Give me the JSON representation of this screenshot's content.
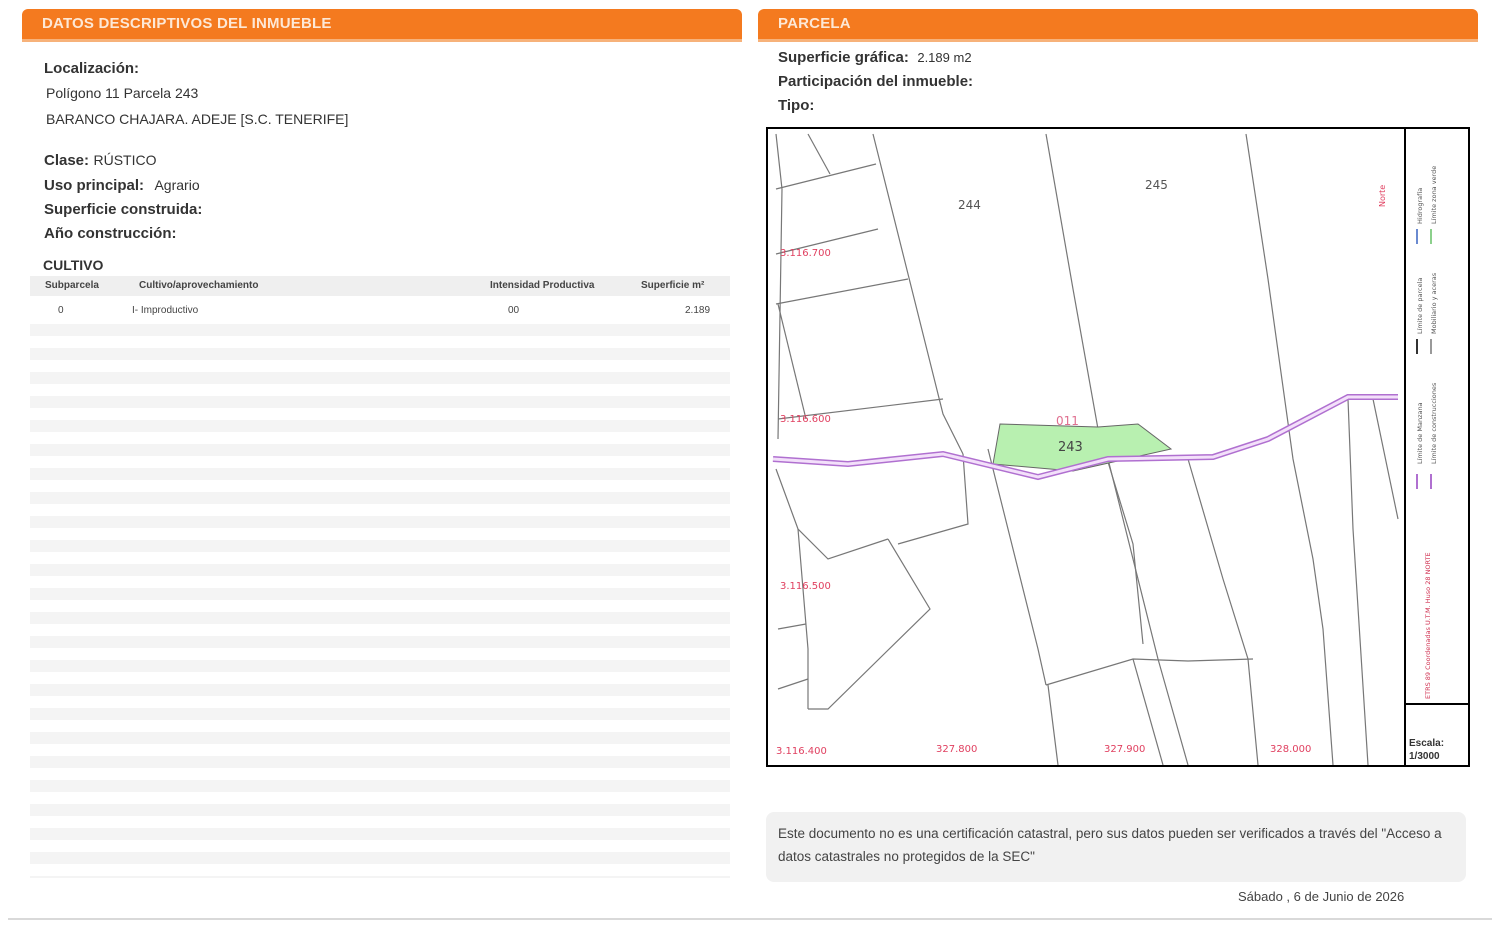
{
  "left": {
    "header": "DATOS DESCRIPTIVOS DEL INMUEBLE",
    "localizacion_label": "Localización:",
    "localizacion_line1": "Polígono 11 Parcela 243",
    "localizacion_line2": "BARANCO CHAJARA. ADEJE [S.C. TENERIFE]",
    "clase_label": "Clase:",
    "clase_value": "RÚSTICO",
    "uso_label": "Uso principal:",
    "uso_value": "Agrario",
    "sup_construida_label": "Superficie construida:",
    "anio_label": "Año construcción:",
    "cultivo_title": "CULTIVO",
    "columns": [
      "Subparcela",
      "Cultivo/aprovechamiento",
      "Intensidad Productiva",
      "Superficie m²"
    ],
    "row": {
      "subparcela": "0",
      "cultivo": "I- Improductivo",
      "intensidad": "00",
      "superficie": "2.189"
    }
  },
  "right": {
    "header": "PARCELA",
    "sup_grafica_label": "Superficie gráfica:",
    "sup_grafica_value": "2.189 m2",
    "participacion_label": "Participación del inmueble:",
    "tipo_label": "Tipo:",
    "map": {
      "parcel_labels": [
        "244",
        "245",
        "243"
      ],
      "poligono_label": "011",
      "y_coords": [
        "3.116.700",
        "3.116.600",
        "3.116.500",
        "3.116.400"
      ],
      "x_coords": [
        "327.800",
        "327.900",
        "328.000"
      ],
      "escala_label": "Escala:",
      "escala_value": "1/3000",
      "legend_items": [
        "Límite de Manzana",
        "Límite de construcciones",
        "Límite de parcela",
        "Mobiliario y aceras",
        "Hidrografía",
        "Límite zona verde"
      ],
      "crs_text": "ETRS 89 Coordenadas U.T.M. Huso 28 NORTE",
      "north_text": "Norte",
      "colors": {
        "parcel_fill": "#b8f0b0",
        "road": "#b070d0",
        "coord": "#e04060"
      }
    },
    "note": "Este documento no es una certificación catastral, pero sus datos pueden ser verificados a través del \"Acceso a datos catastrales no protegidos de la SEC\"",
    "date": "Sábado , 6 de Junio de 2026"
  }
}
